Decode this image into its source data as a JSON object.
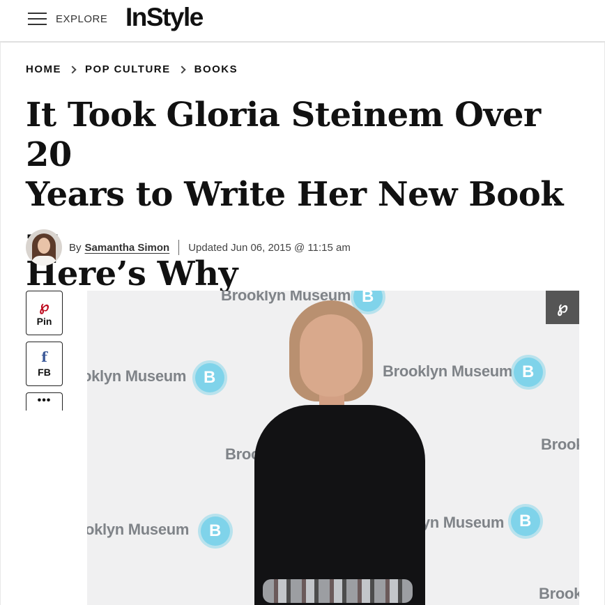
{
  "header": {
    "menu_icon": "hamburger-icon",
    "explore_label": "EXPLORE",
    "logo_text": "InStyle"
  },
  "breadcrumb": {
    "items": [
      "HOME",
      "POP CULTURE",
      "BOOKS"
    ],
    "separator_icon": "chevron-right-icon"
  },
  "article": {
    "headline_line1": "It Took Gloria Steinem Over 20",
    "headline_line2": "Years to Write Her New Book—",
    "headline_line3": "Here’s Why",
    "by_prefix": "By",
    "author": "Samantha Simon",
    "updated": "Updated Jun 06, 2015 @ 11:15 am"
  },
  "share": {
    "pin_icon": "pinterest-icon",
    "pin_label": "Pin",
    "fb_icon": "facebook-icon",
    "fb_label": "FB",
    "more_icon": "more-dots-icon"
  },
  "photo": {
    "backdrop_text": "Brooklyn Museum",
    "pin_overlay_icon": "pinterest-icon",
    "colors": {
      "backdrop": "#f0f0f1",
      "logo_burst": "#7fd3ea",
      "dress": "#121214"
    }
  }
}
